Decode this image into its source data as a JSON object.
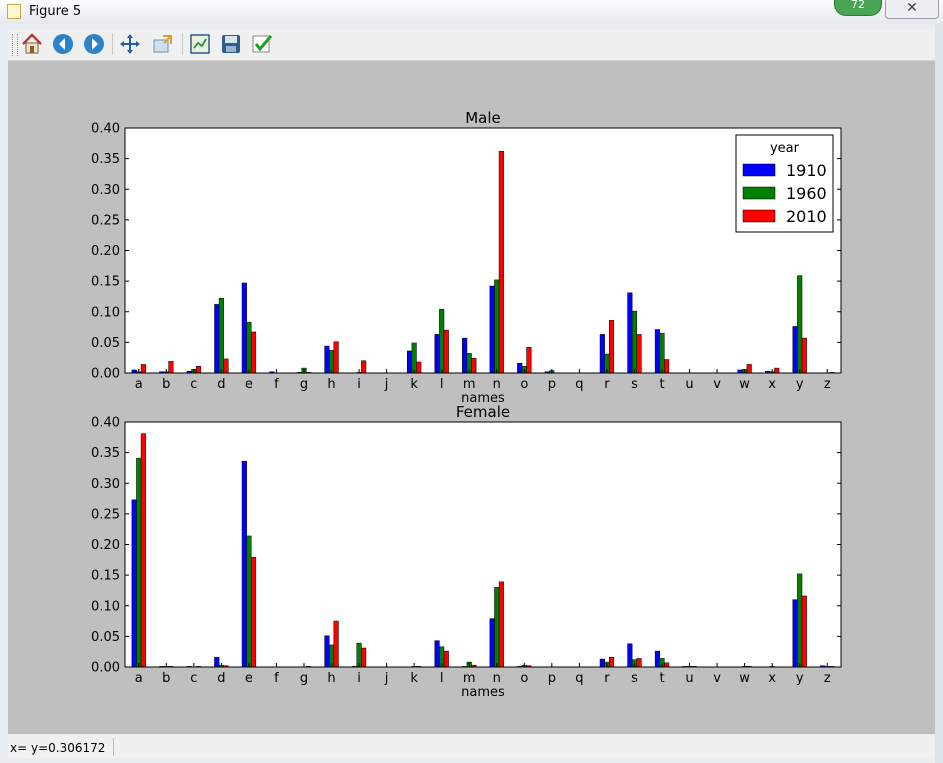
{
  "window": {
    "title": "Figure 5",
    "badge": "72",
    "close_label": "✕"
  },
  "toolbar": {
    "buttons": [
      "home",
      "back",
      "forward",
      "pan",
      "zoom",
      "subplots",
      "save",
      "apply"
    ]
  },
  "status": {
    "text": "x= y=0.306172"
  },
  "colors": {
    "1910": "#0000ff",
    "1960": "#008000",
    "2010": "#ff0000",
    "canvas": "#bfbfbf"
  },
  "chart_data": [
    {
      "type": "bar",
      "title": "Male",
      "xlabel": "names",
      "ylabel": "",
      "ylim": [
        0,
        0.4
      ],
      "yticks": [
        "0.00",
        "0.05",
        "0.10",
        "0.15",
        "0.20",
        "0.25",
        "0.30",
        "0.35",
        "0.40"
      ],
      "categories": [
        "a",
        "b",
        "c",
        "d",
        "e",
        "f",
        "g",
        "h",
        "i",
        "j",
        "k",
        "l",
        "m",
        "n",
        "o",
        "p",
        "q",
        "r",
        "s",
        "t",
        "u",
        "v",
        "w",
        "x",
        "y",
        "z"
      ],
      "legend": {
        "title": "year",
        "position": "top-right"
      },
      "series": [
        {
          "name": "1910",
          "values": [
            0.005,
            0.002,
            0.003,
            0.112,
            0.147,
            0.002,
            0.001,
            0.044,
            0.0,
            0.0,
            0.036,
            0.063,
            0.057,
            0.142,
            0.016,
            0.002,
            0.0,
            0.063,
            0.131,
            0.071,
            0.0,
            0.0,
            0.005,
            0.003,
            0.076,
            0.0
          ]
        },
        {
          "name": "1960",
          "values": [
            0.002,
            0.002,
            0.006,
            0.122,
            0.083,
            0.0,
            0.008,
            0.037,
            0.001,
            0.0,
            0.049,
            0.104,
            0.032,
            0.152,
            0.011,
            0.004,
            0.0,
            0.031,
            0.101,
            0.065,
            0.0,
            0.0,
            0.006,
            0.002,
            0.159,
            0.0
          ]
        },
        {
          "name": "2010",
          "values": [
            0.014,
            0.019,
            0.011,
            0.023,
            0.067,
            0.0,
            0.001,
            0.051,
            0.02,
            0.0,
            0.018,
            0.07,
            0.024,
            0.362,
            0.042,
            0.0,
            0.0,
            0.086,
            0.063,
            0.022,
            0.0,
            0.0,
            0.014,
            0.008,
            0.057,
            0.001
          ]
        }
      ]
    },
    {
      "type": "bar",
      "title": "Female",
      "xlabel": "names",
      "ylabel": "",
      "ylim": [
        0,
        0.4
      ],
      "yticks": [
        "0.00",
        "0.05",
        "0.10",
        "0.15",
        "0.20",
        "0.25",
        "0.30",
        "0.35",
        "0.40"
      ],
      "categories": [
        "a",
        "b",
        "c",
        "d",
        "e",
        "f",
        "g",
        "h",
        "i",
        "j",
        "k",
        "l",
        "m",
        "n",
        "o",
        "p",
        "q",
        "r",
        "s",
        "t",
        "u",
        "v",
        "w",
        "x",
        "y",
        "z"
      ],
      "series": [
        {
          "name": "1910",
          "values": [
            0.273,
            0.001,
            0.001,
            0.016,
            0.336,
            0.0,
            0.0,
            0.051,
            0.001,
            0.0,
            0.0,
            0.043,
            0.001,
            0.079,
            0.001,
            0.0,
            0.0,
            0.013,
            0.038,
            0.026,
            0.001,
            0.0,
            0.0,
            0.0,
            0.11,
            0.002
          ]
        },
        {
          "name": "1960",
          "values": [
            0.341,
            0.001,
            0.0,
            0.003,
            0.214,
            0.0,
            0.0,
            0.036,
            0.039,
            0.0,
            0.001,
            0.033,
            0.008,
            0.13,
            0.003,
            0.0,
            0.0,
            0.008,
            0.012,
            0.014,
            0.001,
            0.0,
            0.001,
            0.001,
            0.152,
            0.001
          ]
        },
        {
          "name": "2010",
          "values": [
            0.381,
            0.001,
            0.001,
            0.002,
            0.179,
            0.0,
            0.001,
            0.075,
            0.031,
            0.0,
            0.001,
            0.026,
            0.003,
            0.139,
            0.002,
            0.0,
            0.0,
            0.016,
            0.014,
            0.007,
            0.001,
            0.0,
            0.001,
            0.0,
            0.116,
            0.001
          ]
        }
      ]
    }
  ]
}
